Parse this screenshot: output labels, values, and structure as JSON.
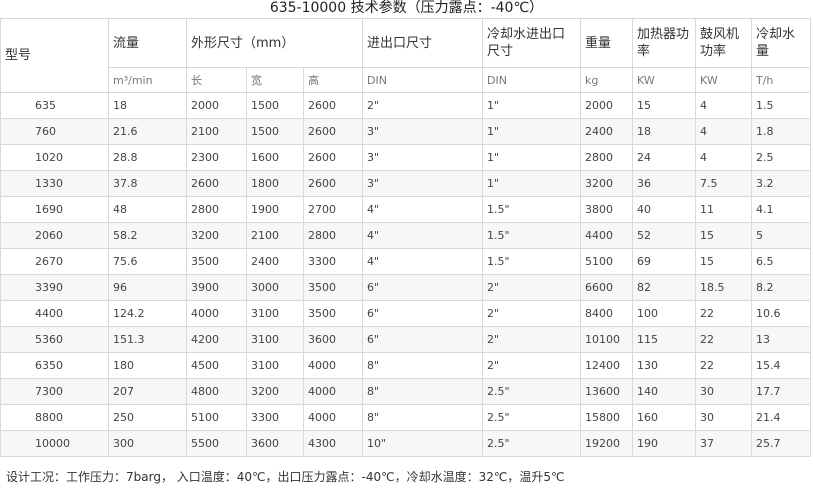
{
  "title": "635-10000 技术参数（压力露点：-40℃）",
  "headers": {
    "model": "型号",
    "flow": "流量",
    "dimensions": "外形尺寸（mm）",
    "inlet_outlet": "进出口尺寸",
    "cooling_water_inlet_outlet": "冷却水进出口尺寸",
    "weight": "重量",
    "heater_power": "加热器功率",
    "blower_power": "鼓风机功率",
    "cooling_water": "冷却水量"
  },
  "units": {
    "flow": "m³/min",
    "length": "长",
    "width": "宽",
    "height": "高",
    "inlet_outlet": "DIN",
    "cooling_water_inlet_outlet": "DIN",
    "weight": "kg",
    "heater_power": "KW",
    "blower_power": "KW",
    "cooling_water": "T/h"
  },
  "rows": [
    {
      "model": "635",
      "flow": "18",
      "length": "2000",
      "width": "1500",
      "height": "2600",
      "inlet": "2\"",
      "water_inlet": "1\"",
      "weight": "2000",
      "heater": "15",
      "blower": "4",
      "water": "1.5"
    },
    {
      "model": "760",
      "flow": "21.6",
      "length": "2100",
      "width": "1500",
      "height": "2600",
      "inlet": "3\"",
      "water_inlet": "1\"",
      "weight": "2400",
      "heater": "18",
      "blower": "4",
      "water": "1.8"
    },
    {
      "model": "1020",
      "flow": "28.8",
      "length": "2300",
      "width": "1600",
      "height": "2600",
      "inlet": "3\"",
      "water_inlet": "1\"",
      "weight": "2800",
      "heater": "24",
      "blower": "4",
      "water": "2.5"
    },
    {
      "model": "1330",
      "flow": "37.8",
      "length": "2600",
      "width": "1800",
      "height": "2600",
      "inlet": "3\"",
      "water_inlet": "1\"",
      "weight": "3200",
      "heater": "36",
      "blower": "7.5",
      "water": "3.2"
    },
    {
      "model": "1690",
      "flow": "48",
      "length": "2800",
      "width": "1900",
      "height": "2700",
      "inlet": "4\"",
      "water_inlet": "1.5\"",
      "weight": "3800",
      "heater": "40",
      "blower": "11",
      "water": "4.1"
    },
    {
      "model": "2060",
      "flow": "58.2",
      "length": "3200",
      "width": "2100",
      "height": "2800",
      "inlet": "4\"",
      "water_inlet": "1.5\"",
      "weight": "4400",
      "heater": "52",
      "blower": "15",
      "water": "5"
    },
    {
      "model": "2670",
      "flow": "75.6",
      "length": "3500",
      "width": "2400",
      "height": "3300",
      "inlet": "4\"",
      "water_inlet": "1.5\"",
      "weight": "5100",
      "heater": "69",
      "blower": "15",
      "water": "6.5"
    },
    {
      "model": "3390",
      "flow": "96",
      "length": "3900",
      "width": "3000",
      "height": "3500",
      "inlet": "6\"",
      "water_inlet": "2\"",
      "weight": "6600",
      "heater": "82",
      "blower": "18.5",
      "water": "8.2"
    },
    {
      "model": "4400",
      "flow": "124.2",
      "length": "4000",
      "width": "3100",
      "height": "3500",
      "inlet": "6\"",
      "water_inlet": "2\"",
      "weight": "8400",
      "heater": "100",
      "blower": "22",
      "water": "10.6"
    },
    {
      "model": "5360",
      "flow": "151.3",
      "length": "4200",
      "width": "3100",
      "height": "3600",
      "inlet": "6\"",
      "water_inlet": "2\"",
      "weight": "10100",
      "heater": "115",
      "blower": "22",
      "water": "13"
    },
    {
      "model": "6350",
      "flow": "180",
      "length": "4500",
      "width": "3100",
      "height": "4000",
      "inlet": "8\"",
      "water_inlet": "2\"",
      "weight": "12400",
      "heater": "130",
      "blower": "22",
      "water": "15.4"
    },
    {
      "model": "7300",
      "flow": "207",
      "length": "4800",
      "width": "3200",
      "height": "4000",
      "inlet": "8\"",
      "water_inlet": "2.5\"",
      "weight": "13600",
      "heater": "140",
      "blower": "30",
      "water": "17.7"
    },
    {
      "model": "8800",
      "flow": "250",
      "length": "5100",
      "width": "3300",
      "height": "4000",
      "inlet": "8\"",
      "water_inlet": "2.5\"",
      "weight": "15800",
      "heater": "160",
      "blower": "30",
      "water": "21.4"
    },
    {
      "model": "10000",
      "flow": "300",
      "length": "5500",
      "width": "3600",
      "height": "4300",
      "inlet": "10\"",
      "water_inlet": "2.5\"",
      "weight": "19200",
      "heater": "190",
      "blower": "37",
      "water": "25.7"
    }
  ],
  "footer": "设计工况：工作压力：7barg， 入口温度：40℃，出口压力露点：-40℃，冷却水温度：32℃，温升5℃"
}
